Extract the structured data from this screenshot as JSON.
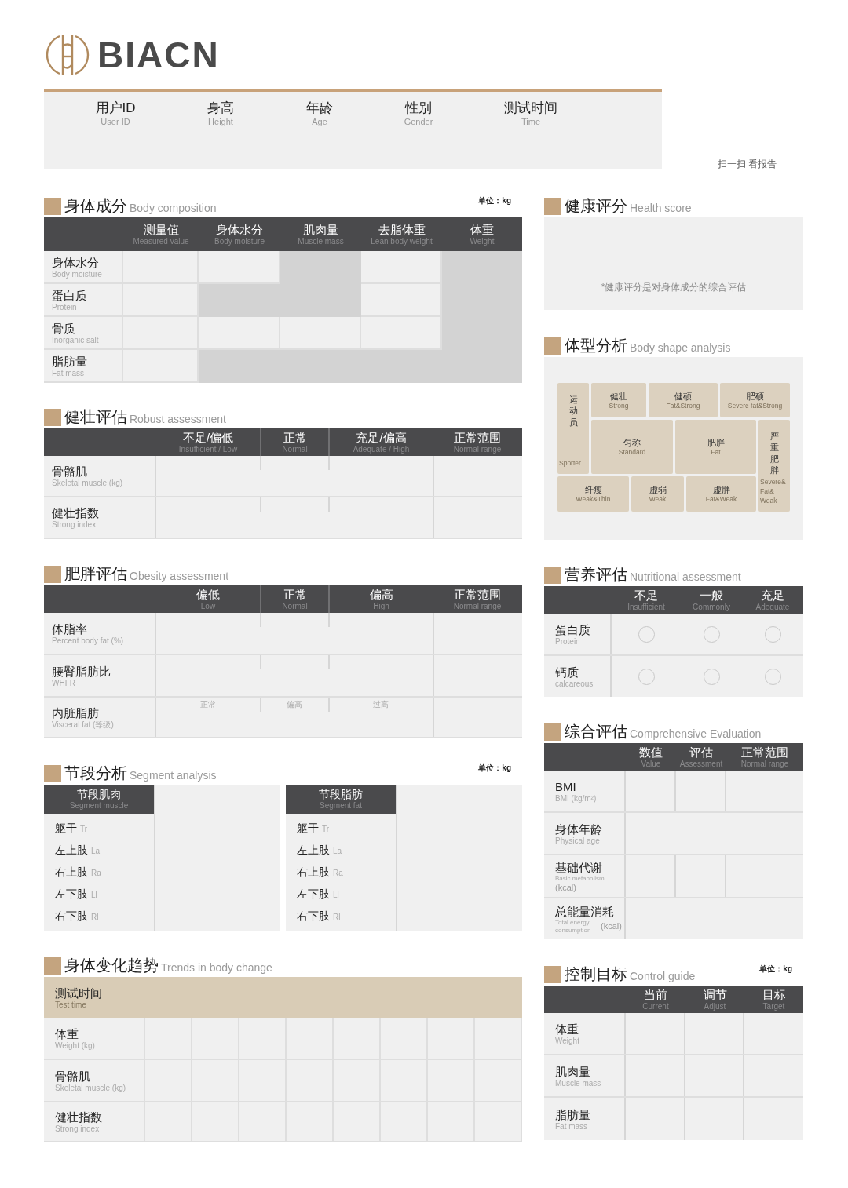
{
  "logo": {
    "text": "BIACN"
  },
  "user_info": {
    "fields": [
      {
        "label": "用户ID",
        "sublabel": "User ID"
      },
      {
        "label": "身高",
        "sublabel": "Height"
      },
      {
        "label": "年龄",
        "sublabel": "Age"
      },
      {
        "label": "性别",
        "sublabel": "Gender"
      },
      {
        "label": "测试时间",
        "sublabel": "Time"
      }
    ],
    "scan_note": "扫一扫 看报告"
  },
  "body_composition": {
    "title": "身体成分",
    "subtitle": "Body composition",
    "unit": "单位：kg",
    "columns": [
      {
        "label": "测量值",
        "sublabel": "Measured value"
      },
      {
        "label": "身体水分",
        "sublabel": "Body moisture"
      },
      {
        "label": "肌肉量",
        "sublabel": "Muscle mass"
      },
      {
        "label": "去脂体重",
        "sublabel": "Lean body weight"
      },
      {
        "label": "体重",
        "sublabel": "Weight"
      }
    ],
    "rows": [
      {
        "label": "身体水分",
        "sublabel": "Body moisture",
        "shaded": [
          false,
          false,
          true,
          false,
          true
        ]
      },
      {
        "label": "蛋白质",
        "sublabel": "Protein",
        "shaded": [
          false,
          true,
          true,
          false,
          true
        ]
      },
      {
        "label": "骨质",
        "sublabel": "Inorganic salt",
        "shaded": [
          false,
          false,
          false,
          false,
          true
        ]
      },
      {
        "label": "脂肪量",
        "sublabel": "Fat mass",
        "shaded": [
          false,
          true,
          true,
          true,
          true
        ]
      }
    ]
  },
  "robust_assessment": {
    "title": "健壮评估",
    "subtitle": "Robust assessment",
    "columns": [
      {
        "label": "不足/偏低",
        "sublabel": "Insufficient / Low"
      },
      {
        "label": "正常",
        "sublabel": "Normal"
      },
      {
        "label": "充足/偏高",
        "sublabel": "Adequate / High"
      },
      {
        "label": "正常范围",
        "sublabel": "Normal range"
      }
    ],
    "rows": [
      {
        "label": "骨骼肌",
        "sublabel": "Skeletal muscle (kg)"
      },
      {
        "label": "健壮指数",
        "sublabel": "Strong index"
      }
    ]
  },
  "obesity_assessment": {
    "title": "肥胖评估",
    "subtitle": "Obesity assessment",
    "columns": [
      {
        "label": "偏低",
        "sublabel": "Low"
      },
      {
        "label": "正常",
        "sublabel": "Normal"
      },
      {
        "label": "偏高",
        "sublabel": "High"
      },
      {
        "label": "正常范围",
        "sublabel": "Normal range"
      }
    ],
    "rows": [
      {
        "label": "体脂率",
        "sublabel": "Percent body fat (%)"
      },
      {
        "label": "腰臀脂肪比",
        "sublabel": "WHFR"
      },
      {
        "label": "内脏脂肪",
        "sublabel": "Visceral fat (等级)",
        "scale": [
          "正常",
          "偏高",
          "过高"
        ]
      }
    ]
  },
  "segment_analysis": {
    "title": "节段分析",
    "subtitle": "Segment analysis",
    "unit": "单位：kg",
    "panels": [
      {
        "label": "节段肌肉",
        "sublabel": "Segment muscle",
        "rows": [
          {
            "label": "躯干",
            "code": "Tr"
          },
          {
            "label": "左上肢",
            "code": "La"
          },
          {
            "label": "右上肢",
            "code": "Ra"
          },
          {
            "label": "左下肢",
            "code": "Ll"
          },
          {
            "label": "右下肢",
            "code": "Rl"
          }
        ]
      },
      {
        "label": "节段脂肪",
        "sublabel": "Segment fat",
        "rows": [
          {
            "label": "躯干",
            "code": "Tr"
          },
          {
            "label": "左上肢",
            "code": "La"
          },
          {
            "label": "右上肢",
            "code": "Ra"
          },
          {
            "label": "左下肢",
            "code": "Ll"
          },
          {
            "label": "右下肢",
            "code": "Rl"
          }
        ]
      }
    ]
  },
  "trends": {
    "title": "身体变化趋势",
    "subtitle": "Trends in body change",
    "header": {
      "label": "测试时间",
      "sublabel": "Test time"
    },
    "rows": [
      {
        "label": "体重",
        "sublabel": "Weight (kg)"
      },
      {
        "label": "骨骼肌",
        "sublabel": "Skeletal muscle (kg)"
      },
      {
        "label": "健壮指数",
        "sublabel": "Strong index"
      }
    ]
  },
  "health_score": {
    "title": "健康评分",
    "subtitle": "Health score",
    "note": "*健康评分是对身体成分的综合评估"
  },
  "body_shape": {
    "title": "体型分析",
    "subtitle": "Body shape analysis",
    "cells": [
      {
        "label": "运动员",
        "sublabel": "Sporter",
        "kind": "vertical"
      },
      {
        "label": "健壮",
        "sublabel": "Strong",
        "kind": "normal"
      },
      {
        "label": "健硕",
        "sublabel": "Fat&Strong",
        "kind": "normal"
      },
      {
        "label": "肥硕",
        "sublabel": "Severe fat&Strong",
        "kind": "normal"
      },
      {
        "label": "匀称",
        "sublabel": "Standard",
        "kind": "normal"
      },
      {
        "label": "肥胖",
        "sublabel": "Fat",
        "kind": "normal"
      },
      {
        "label": "纤瘦",
        "sublabel": "Weak&Thin",
        "kind": "normal"
      },
      {
        "label": "虚弱",
        "sublabel": "Weak",
        "kind": "normal"
      },
      {
        "label": "虚胖",
        "sublabel": "Fat&Weak",
        "kind": "normal"
      },
      {
        "label": "严重肥胖",
        "sublabel": "Severe& Fat& Weak",
        "kind": "vertical"
      }
    ]
  },
  "nutrition": {
    "title": "营养评估",
    "subtitle": "Nutritional assessment",
    "columns": [
      {
        "label": "不足",
        "sublabel": "Insufficient"
      },
      {
        "label": "一般",
        "sublabel": "Commonly"
      },
      {
        "label": "充足",
        "sublabel": "Adequate"
      }
    ],
    "rows": [
      {
        "label": "蛋白质",
        "sublabel": "Protein",
        "options": [
          {
            "selected": false
          },
          {
            "selected": false
          },
          {
            "selected": false
          }
        ]
      },
      {
        "label": "钙质",
        "sublabel": "calcareous",
        "options": [
          {
            "selected": false
          },
          {
            "selected": false
          },
          {
            "selected": false
          }
        ]
      }
    ]
  },
  "comprehensive": {
    "title": "综合评估",
    "subtitle": "Comprehensive Evaluation",
    "columns": [
      {
        "label": "数值",
        "sublabel": "Value"
      },
      {
        "label": "评估",
        "sublabel": "Assessment"
      },
      {
        "label": "正常范围",
        "sublabel": "Normal range"
      }
    ],
    "rows": [
      {
        "label": "BMI",
        "sublabel": "BMI (kg/m²)",
        "kind": "split"
      },
      {
        "label": "身体年龄",
        "sublabel": "Physical age",
        "kind": "merged"
      },
      {
        "label": "基础代谢",
        "sublabel": "Basic metabolism",
        "unit": "(kcal)",
        "kind": "split"
      },
      {
        "label": "总能量消耗",
        "sublabel": "Total energy consumption",
        "unit": "(kcal)",
        "kind": "merged"
      }
    ]
  },
  "control_guide": {
    "title": "控制目标",
    "subtitle": "Control guide",
    "unit": "单位：kg",
    "columns": [
      {
        "label": "当前",
        "sublabel": "Current"
      },
      {
        "label": "调节",
        "sublabel": "Adjust"
      },
      {
        "label": "目标",
        "sublabel": "Target"
      }
    ],
    "rows": [
      {
        "label": "体重",
        "sublabel": "Weight"
      },
      {
        "label": "肌肉量",
        "sublabel": "Muscle mass"
      },
      {
        "label": "脂肪量",
        "sublabel": "Fat mass"
      }
    ]
  }
}
